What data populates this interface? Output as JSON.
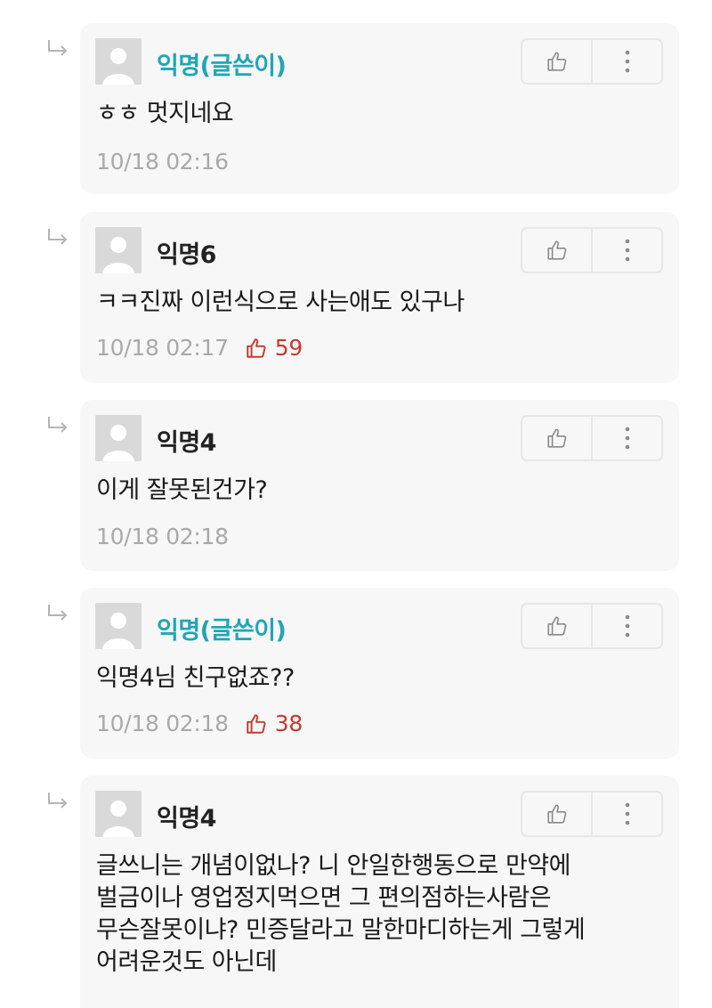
{
  "colors": {
    "op_name": "#1fa6b6",
    "likes": "#c53a32",
    "card_bg": "#f7f7f7"
  },
  "icons": {
    "reply": "reply-arrow-icon",
    "like": "thumbs-up-icon",
    "more": "more-vertical-icon",
    "avatar": "default-avatar-icon"
  },
  "comments": [
    {
      "name": "익명(글쓴이)",
      "is_op": true,
      "text": "ㅎㅎ 멋지네요",
      "time": "10/18 02:16",
      "likes": ""
    },
    {
      "name": "익명6",
      "is_op": false,
      "text": "ㅋㅋ진짜 이런식으로 사는애도 있구나",
      "time": "10/18 02:17",
      "likes": "59"
    },
    {
      "name": "익명4",
      "is_op": false,
      "text": "이게 잘못된건가?",
      "time": "10/18 02:18",
      "likes": ""
    },
    {
      "name": "익명(글쓴이)",
      "is_op": true,
      "text": "익명4님 친구없죠??",
      "time": "10/18 02:18",
      "likes": "38"
    },
    {
      "name": "익명4",
      "is_op": false,
      "text": "글쓰니는 개념이없나? 니 안일한행동으로 만약에\n벌금이나 영업정지먹으면 그 편의점하는사람은\n무슨잘못이냐? 민증달라고 말한마디하는게 그렇게\n어려운것도 아닌데",
      "time": "",
      "likes": ""
    }
  ]
}
